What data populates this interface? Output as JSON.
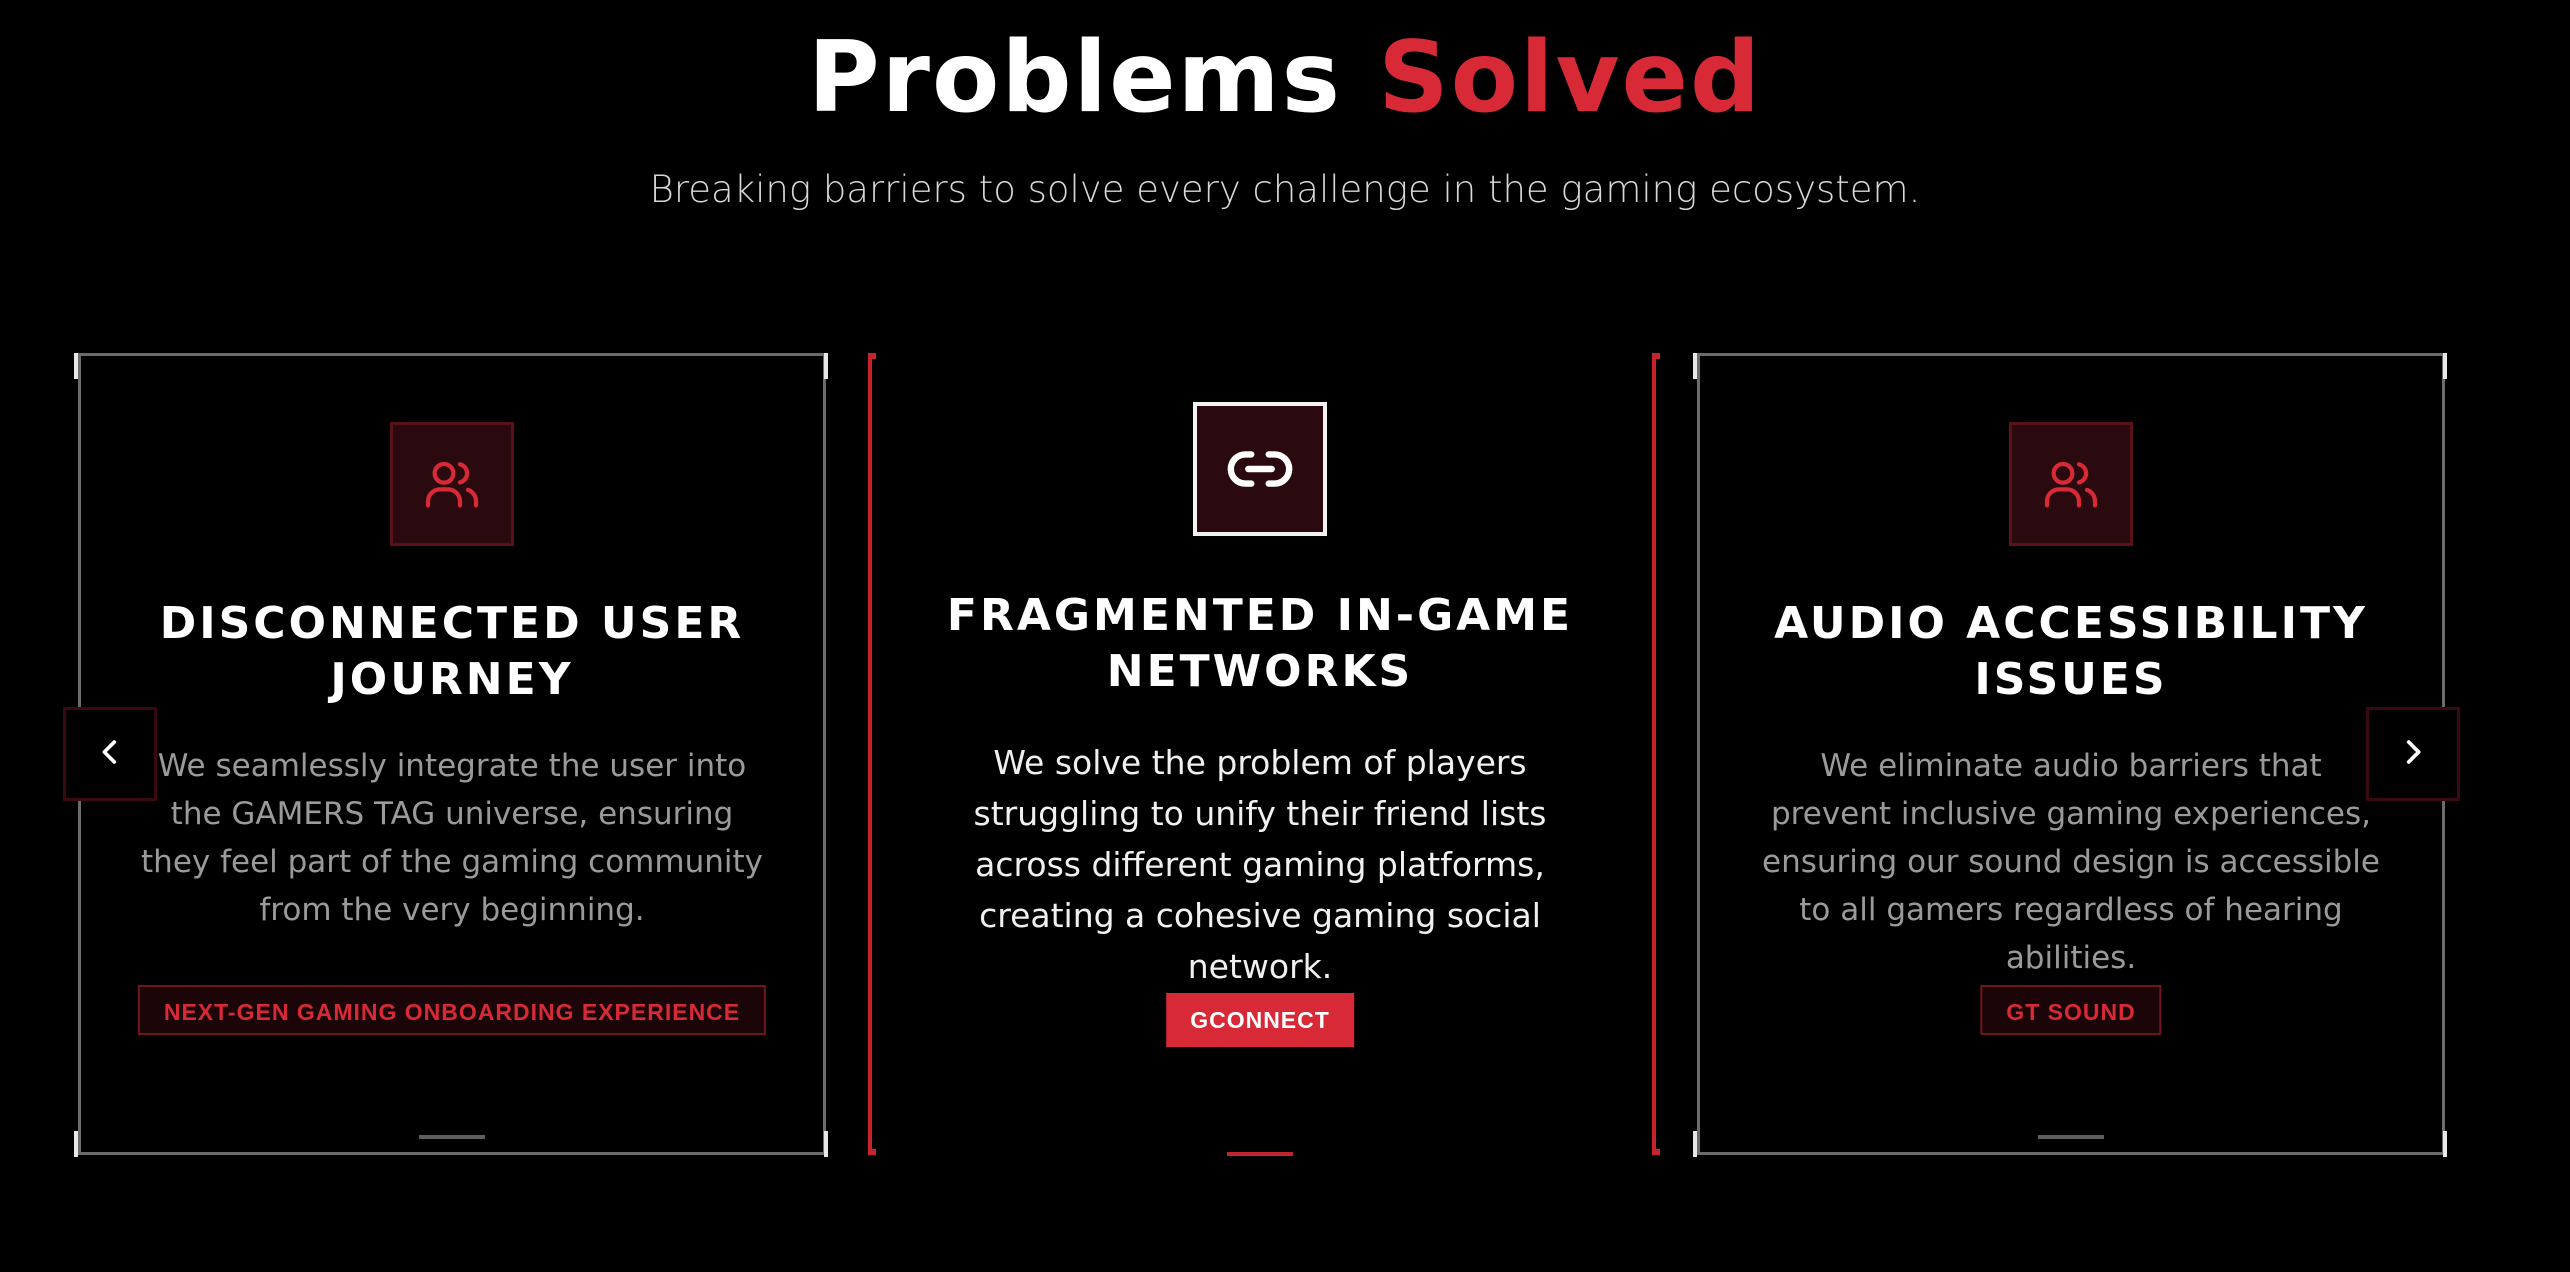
{
  "header": {
    "title_main": "Problems",
    "title_accent": "Solved",
    "subtitle": "Breaking barriers to solve every challenge in the gaming ecosystem."
  },
  "colors": {
    "accent": "#d72a36",
    "background": "#000000",
    "card_border": "#6b6b6b"
  },
  "carousel": {
    "prev_icon": "chevron-left-icon",
    "next_icon": "chevron-right-icon",
    "cards": [
      {
        "icon": "users-icon",
        "title": "DISCONNECTED USER JOURNEY",
        "description": "We seamlessly integrate the user into the GAMERS TAG universe, ensuring they feel part of the gaming community from the very beginning.",
        "tag": "NEXT-GEN GAMING ONBOARDING EXPERIENCE"
      },
      {
        "icon": "link-icon",
        "title": "FRAGMENTED IN-GAME NETWORKS",
        "description": "We solve the problem of players struggling to unify their friend lists across different gaming platforms, creating a cohesive gaming social network.",
        "tag": "GCONNECT"
      },
      {
        "icon": "users-icon",
        "title": "AUDIO ACCESSIBILITY ISSUES",
        "description": "We eliminate audio barriers that prevent inclusive gaming experiences, ensuring our sound design is accessible to all gamers regardless of hearing abilities.",
        "tag": "GT SOUND"
      }
    ]
  }
}
